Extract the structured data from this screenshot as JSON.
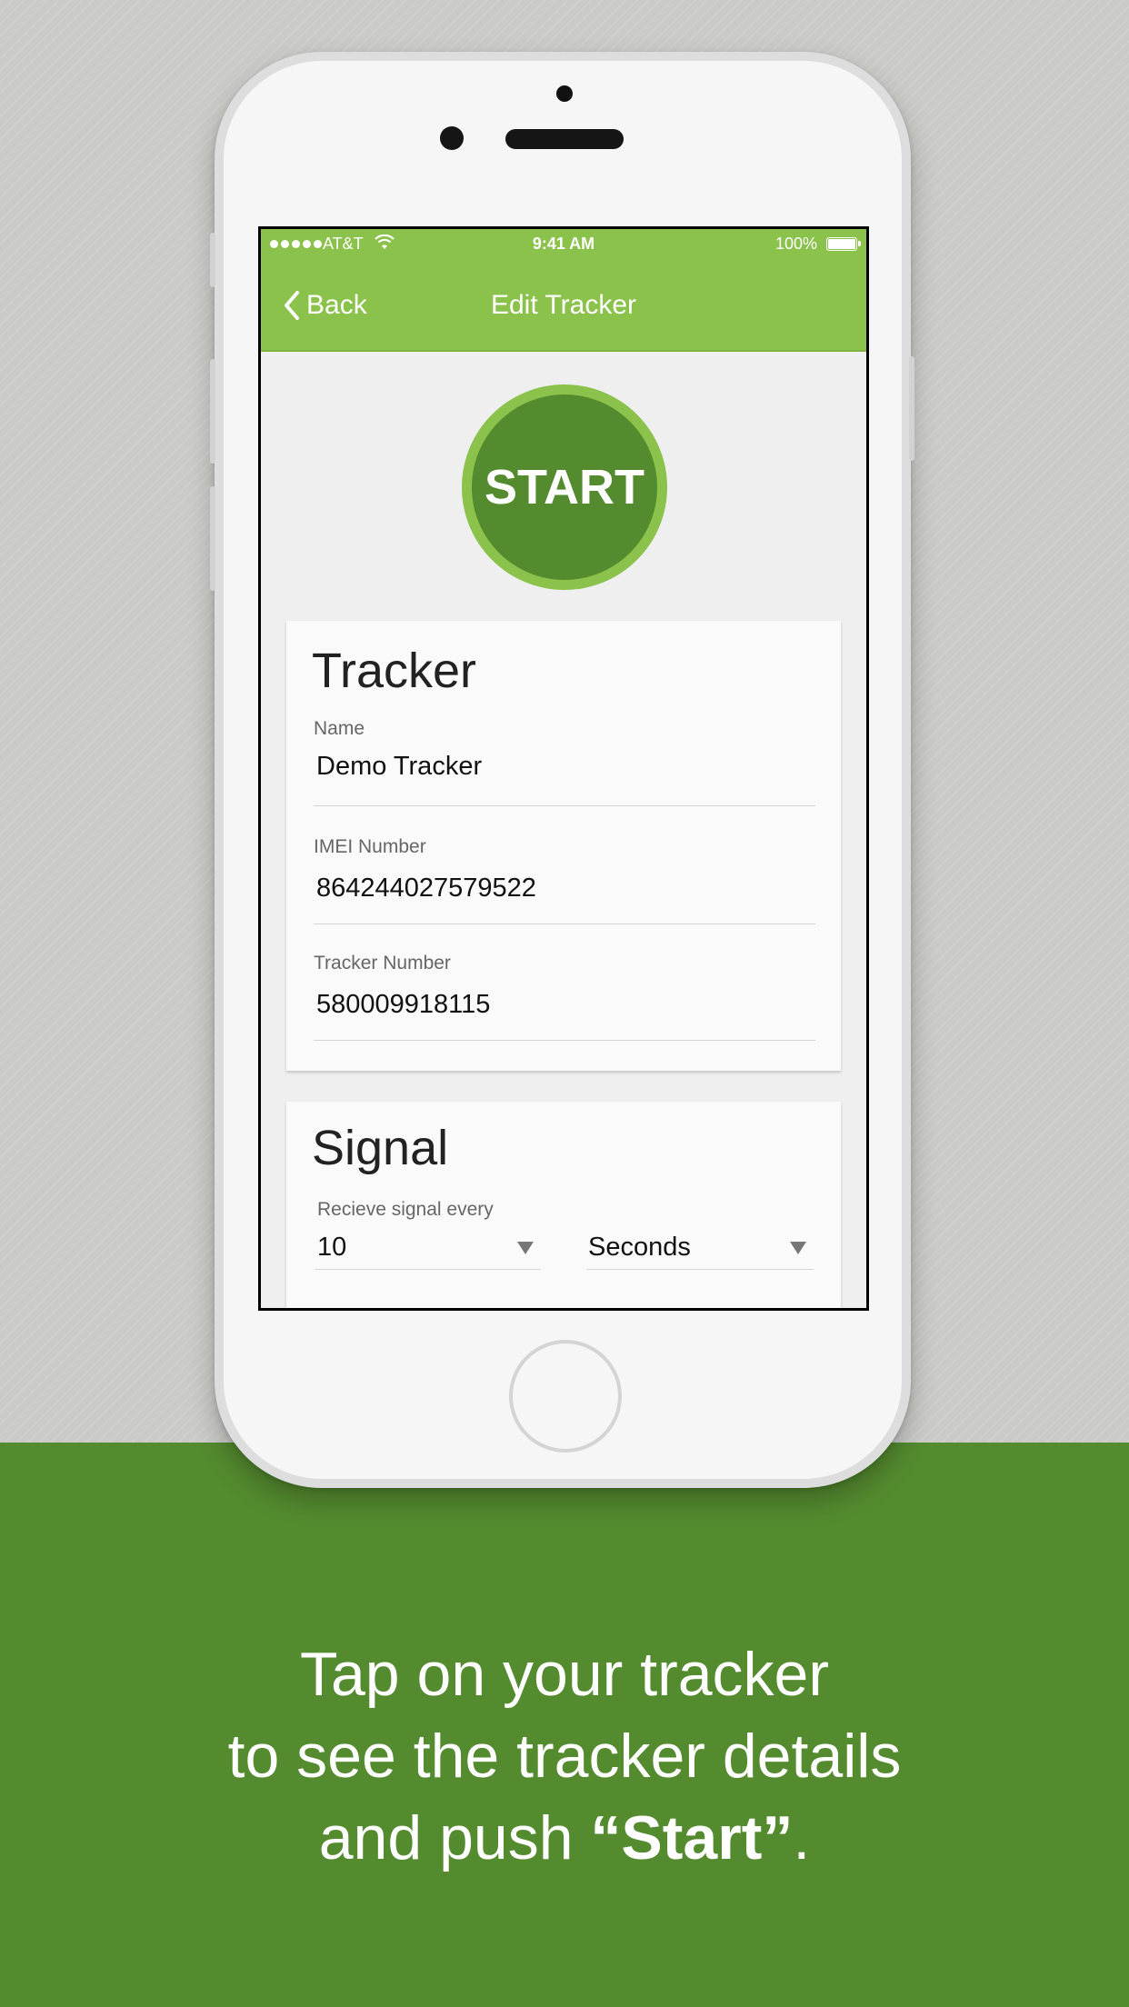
{
  "statusbar": {
    "carrier": "AT&T",
    "time": "9:41 AM",
    "battery": "100%"
  },
  "navbar": {
    "back_label": "Back",
    "title": "Edit Tracker"
  },
  "start_button": {
    "label": "START"
  },
  "tracker_card": {
    "title": "Tracker",
    "fields": [
      {
        "label": "Name",
        "value": "Demo Tracker"
      },
      {
        "label": "IMEI Number",
        "value": "864244027579522"
      },
      {
        "label": "Tracker Number",
        "value": "580009918115"
      }
    ]
  },
  "signal_card": {
    "title": "Signal",
    "label": "Recieve signal every",
    "interval_value": "10",
    "interval_unit": "Seconds"
  },
  "tagline": {
    "line1": "Tap on your tracker",
    "line2": "to see the tracker details",
    "line3_prefix": "and push ",
    "line3_bold": "“Start”",
    "line3_suffix": "."
  },
  "colors": {
    "bar_green": "#8bc24c",
    "dark_green": "#548b2f",
    "background_gray": "#cacbc7"
  },
  "icons": [
    "signal-dots-icon",
    "wifi-icon",
    "battery-icon",
    "chevron-left-icon",
    "dropdown-caret-icon"
  ]
}
